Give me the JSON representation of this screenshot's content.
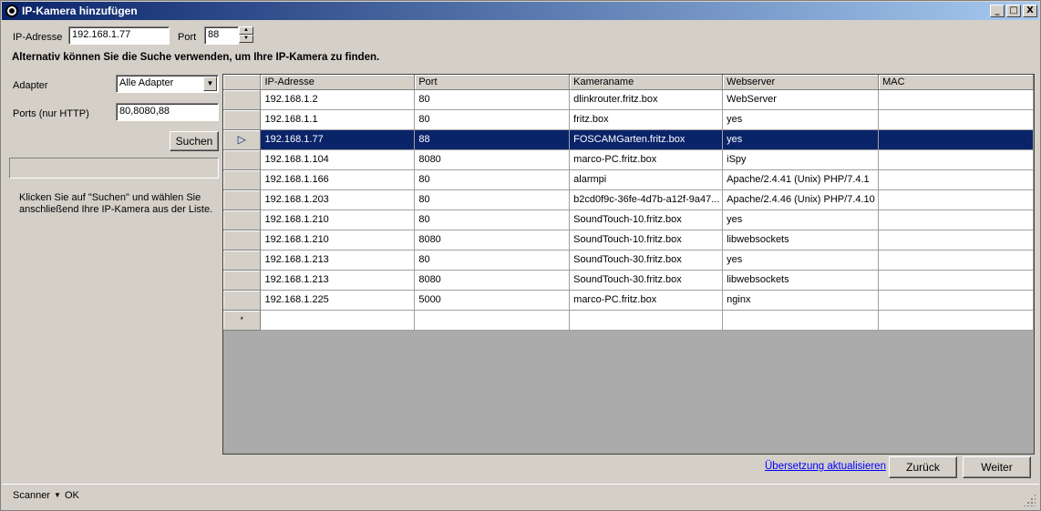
{
  "window": {
    "title": "IP-Kamera hinzufügen",
    "controls": {
      "minimize": "_",
      "maximize": "□",
      "close": "X"
    }
  },
  "form": {
    "ip_label": "IP-Adresse",
    "ip_value": "192.168.1.77",
    "port_label": "Port",
    "port_value": "88",
    "hint": "Alternativ können Sie die Suche verwenden, um Ihre IP-Kamera zu finden.",
    "adapter_label": "Adapter",
    "adapter_value": "Alle Adapter",
    "ports_label": "Ports (nur HTTP)",
    "ports_value": "80,8080,88",
    "search_button": "Suchen",
    "info_text": "Klicken Sie auf \"Suchen\" und wählen Sie\nanschließend Ihre IP-Kamera aus der Liste."
  },
  "table": {
    "columns": [
      "IP-Adresse",
      "Port",
      "Kameraname",
      "Webserver",
      "MAC"
    ],
    "rows": [
      [
        "192.168.1.2",
        "80",
        "dlinkrouter.fritz.box",
        "WebServer",
        ""
      ],
      [
        "192.168.1.1",
        "80",
        "fritz.box",
        "yes",
        ""
      ],
      [
        "192.168.1.77",
        "88",
        "FOSCAMGarten.fritz.box",
        "yes",
        ""
      ],
      [
        "192.168.1.104",
        "8080",
        "marco-PC.fritz.box",
        "iSpy",
        ""
      ],
      [
        "192.168.1.166",
        "80",
        "alarmpi",
        "Apache/2.4.41 (Unix) PHP/7.4.1",
        ""
      ],
      [
        "192.168.1.203",
        "80",
        "b2cd0f9c-36fe-4d7b-a12f-9a47...",
        "Apache/2.4.46 (Unix) PHP/7.4.10",
        ""
      ],
      [
        "192.168.1.210",
        "80",
        "SoundTouch-10.fritz.box",
        "yes",
        ""
      ],
      [
        "192.168.1.210",
        "8080",
        "SoundTouch-10.fritz.box",
        "libwebsockets",
        ""
      ],
      [
        "192.168.1.213",
        "80",
        "SoundTouch-30.fritz.box",
        "yes",
        ""
      ],
      [
        "192.168.1.213",
        "8080",
        "SoundTouch-30.fritz.box",
        "libwebsockets",
        ""
      ],
      [
        "192.168.1.225",
        "5000",
        "marco-PC.fritz.box",
        "nginx",
        ""
      ]
    ],
    "selected_row": 2,
    "new_row_marker": "*"
  },
  "footer": {
    "link": "Übersetzung aktualisieren",
    "back_button": "Zurück",
    "next_button": "Weiter"
  },
  "status": {
    "label": "Scanner",
    "value": "OK"
  },
  "colors": {
    "selection": "#0a246a",
    "titlebar_start": "#0a246a",
    "titlebar_end": "#a6caf0",
    "link": "#0000ff"
  }
}
